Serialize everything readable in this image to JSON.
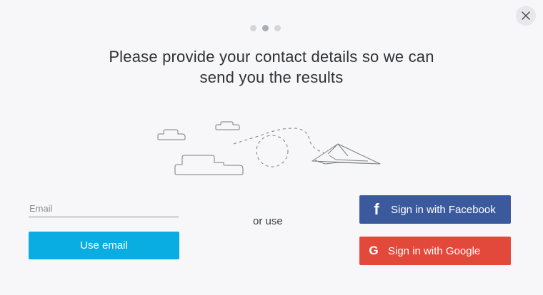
{
  "dialog": {
    "close_icon": "close-icon",
    "steps": [
      {
        "state": "inactive"
      },
      {
        "state": "active"
      },
      {
        "state": "inactive"
      }
    ],
    "headline_line1": "Please provide your contact details so we can",
    "headline_line2": "send you the results"
  },
  "email": {
    "placeholder": "Email",
    "button_label": "Use email"
  },
  "separator": "or use",
  "social": {
    "facebook": {
      "label": "Sign in with Facebook",
      "icon": "f",
      "color": "#3b5a9e"
    },
    "google": {
      "label": "Sign in with Google",
      "icon": "G",
      "color": "#e3493a"
    }
  },
  "colors": {
    "accent": "#0aade1",
    "background": "#f7f7f9"
  }
}
